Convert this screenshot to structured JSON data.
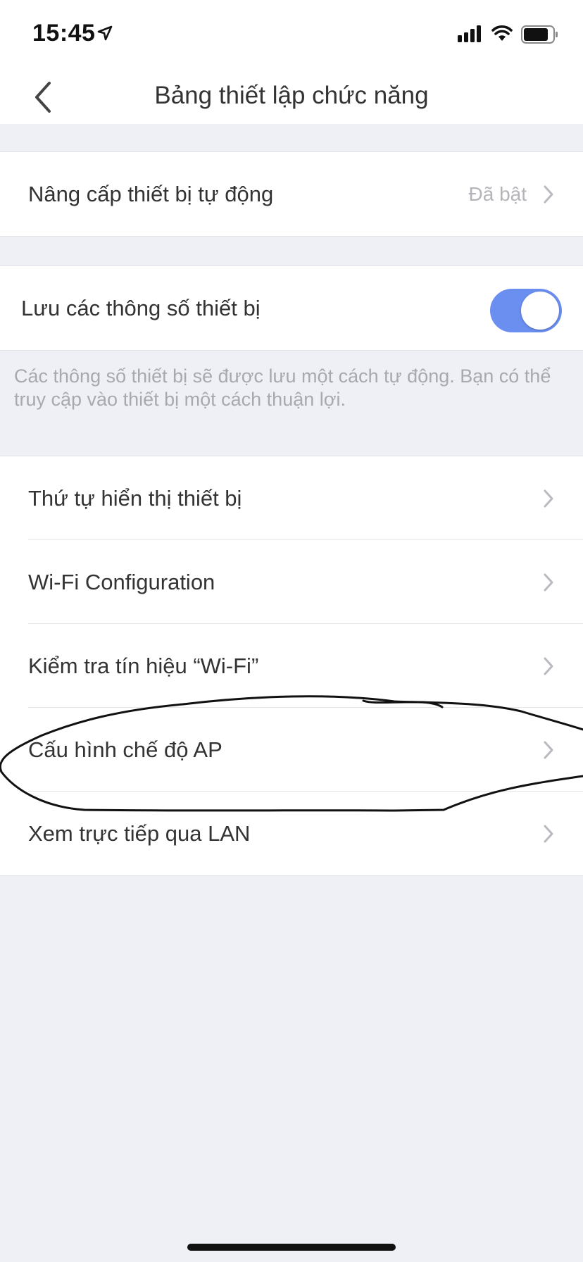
{
  "status_bar": {
    "time": "15:45",
    "icons": [
      "location-arrow-icon",
      "cellular-signal-icon",
      "wifi-icon",
      "battery-icon"
    ]
  },
  "nav": {
    "title": "Bảng thiết lập chức năng",
    "back_icon": "chevron-left-icon"
  },
  "auto_upgrade": {
    "label": "Nâng cấp thiết bị tự động",
    "value": "Đã bật"
  },
  "save_params": {
    "label": "Lưu các thông số thiết bị",
    "toggle_on": true,
    "description": "Các thông số thiết bị sẽ được lưu một cách tự động. Bạn có thể truy cập vào thiết bị một cách thuận lợi."
  },
  "menu": {
    "items": [
      {
        "label": "Thứ tự hiển thị thiết bị"
      },
      {
        "label": "Wi-Fi Configuration"
      },
      {
        "label": "Kiểm tra tín hiệu “Wi-Fi”"
      },
      {
        "label": "Cấu hình chế độ AP"
      },
      {
        "label": "Xem trực tiếp qua LAN"
      }
    ]
  },
  "colors": {
    "accent": "#6b8ff0",
    "background": "#eff0f5",
    "annotation": "#111111"
  }
}
